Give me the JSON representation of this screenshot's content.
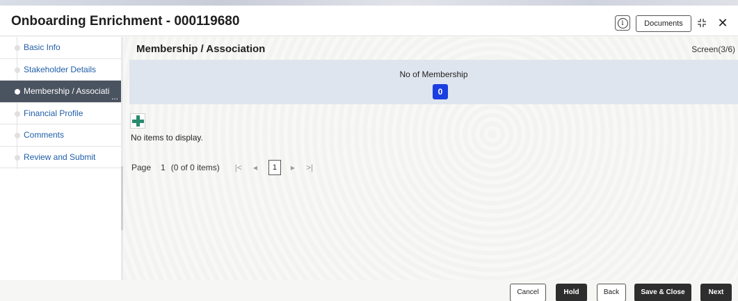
{
  "header": {
    "title": "Onboarding Enrichment - 000119680",
    "info_icon": "info-icon",
    "documents_label": "Documents",
    "shrink_icon": "shrink-icon",
    "close_glyph": "✕"
  },
  "sidebar": {
    "items": [
      {
        "label": "Basic Info",
        "active": false
      },
      {
        "label": "Stakeholder Details",
        "active": false
      },
      {
        "label": "Membership / Associati",
        "active": true,
        "overflow": "..."
      },
      {
        "label": "Financial Profile",
        "active": false
      },
      {
        "label": "Comments",
        "active": false
      },
      {
        "label": "Review and Submit",
        "active": false
      }
    ]
  },
  "main": {
    "title": "Membership / Association",
    "screen_indicator": "Screen(3/6)",
    "summary": {
      "label": "No of Membership",
      "count": "0"
    },
    "add_icon": "plus-icon",
    "empty_message": "No items to display.",
    "pager": {
      "page_label": "Page",
      "page_number": "1",
      "items_text": "(0 of 0 items)",
      "first_glyph": "|<",
      "prev_glyph": "◂",
      "current_page": "1",
      "next_glyph": "▸",
      "last_glyph": ">|"
    }
  },
  "footer": {
    "cancel_label": "Cancel",
    "hold_label": "Hold",
    "back_label": "Back",
    "save_close_label": "Save & Close",
    "next_label": "Next"
  },
  "colors": {
    "accent_blue": "#1a3ee0",
    "sidebar_link": "#1f5ea8",
    "active_item_bg": "#4a5360",
    "summary_band": "#dfe5ee",
    "add_green": "#2a8a6e",
    "dark_button": "#2e2e2e"
  }
}
